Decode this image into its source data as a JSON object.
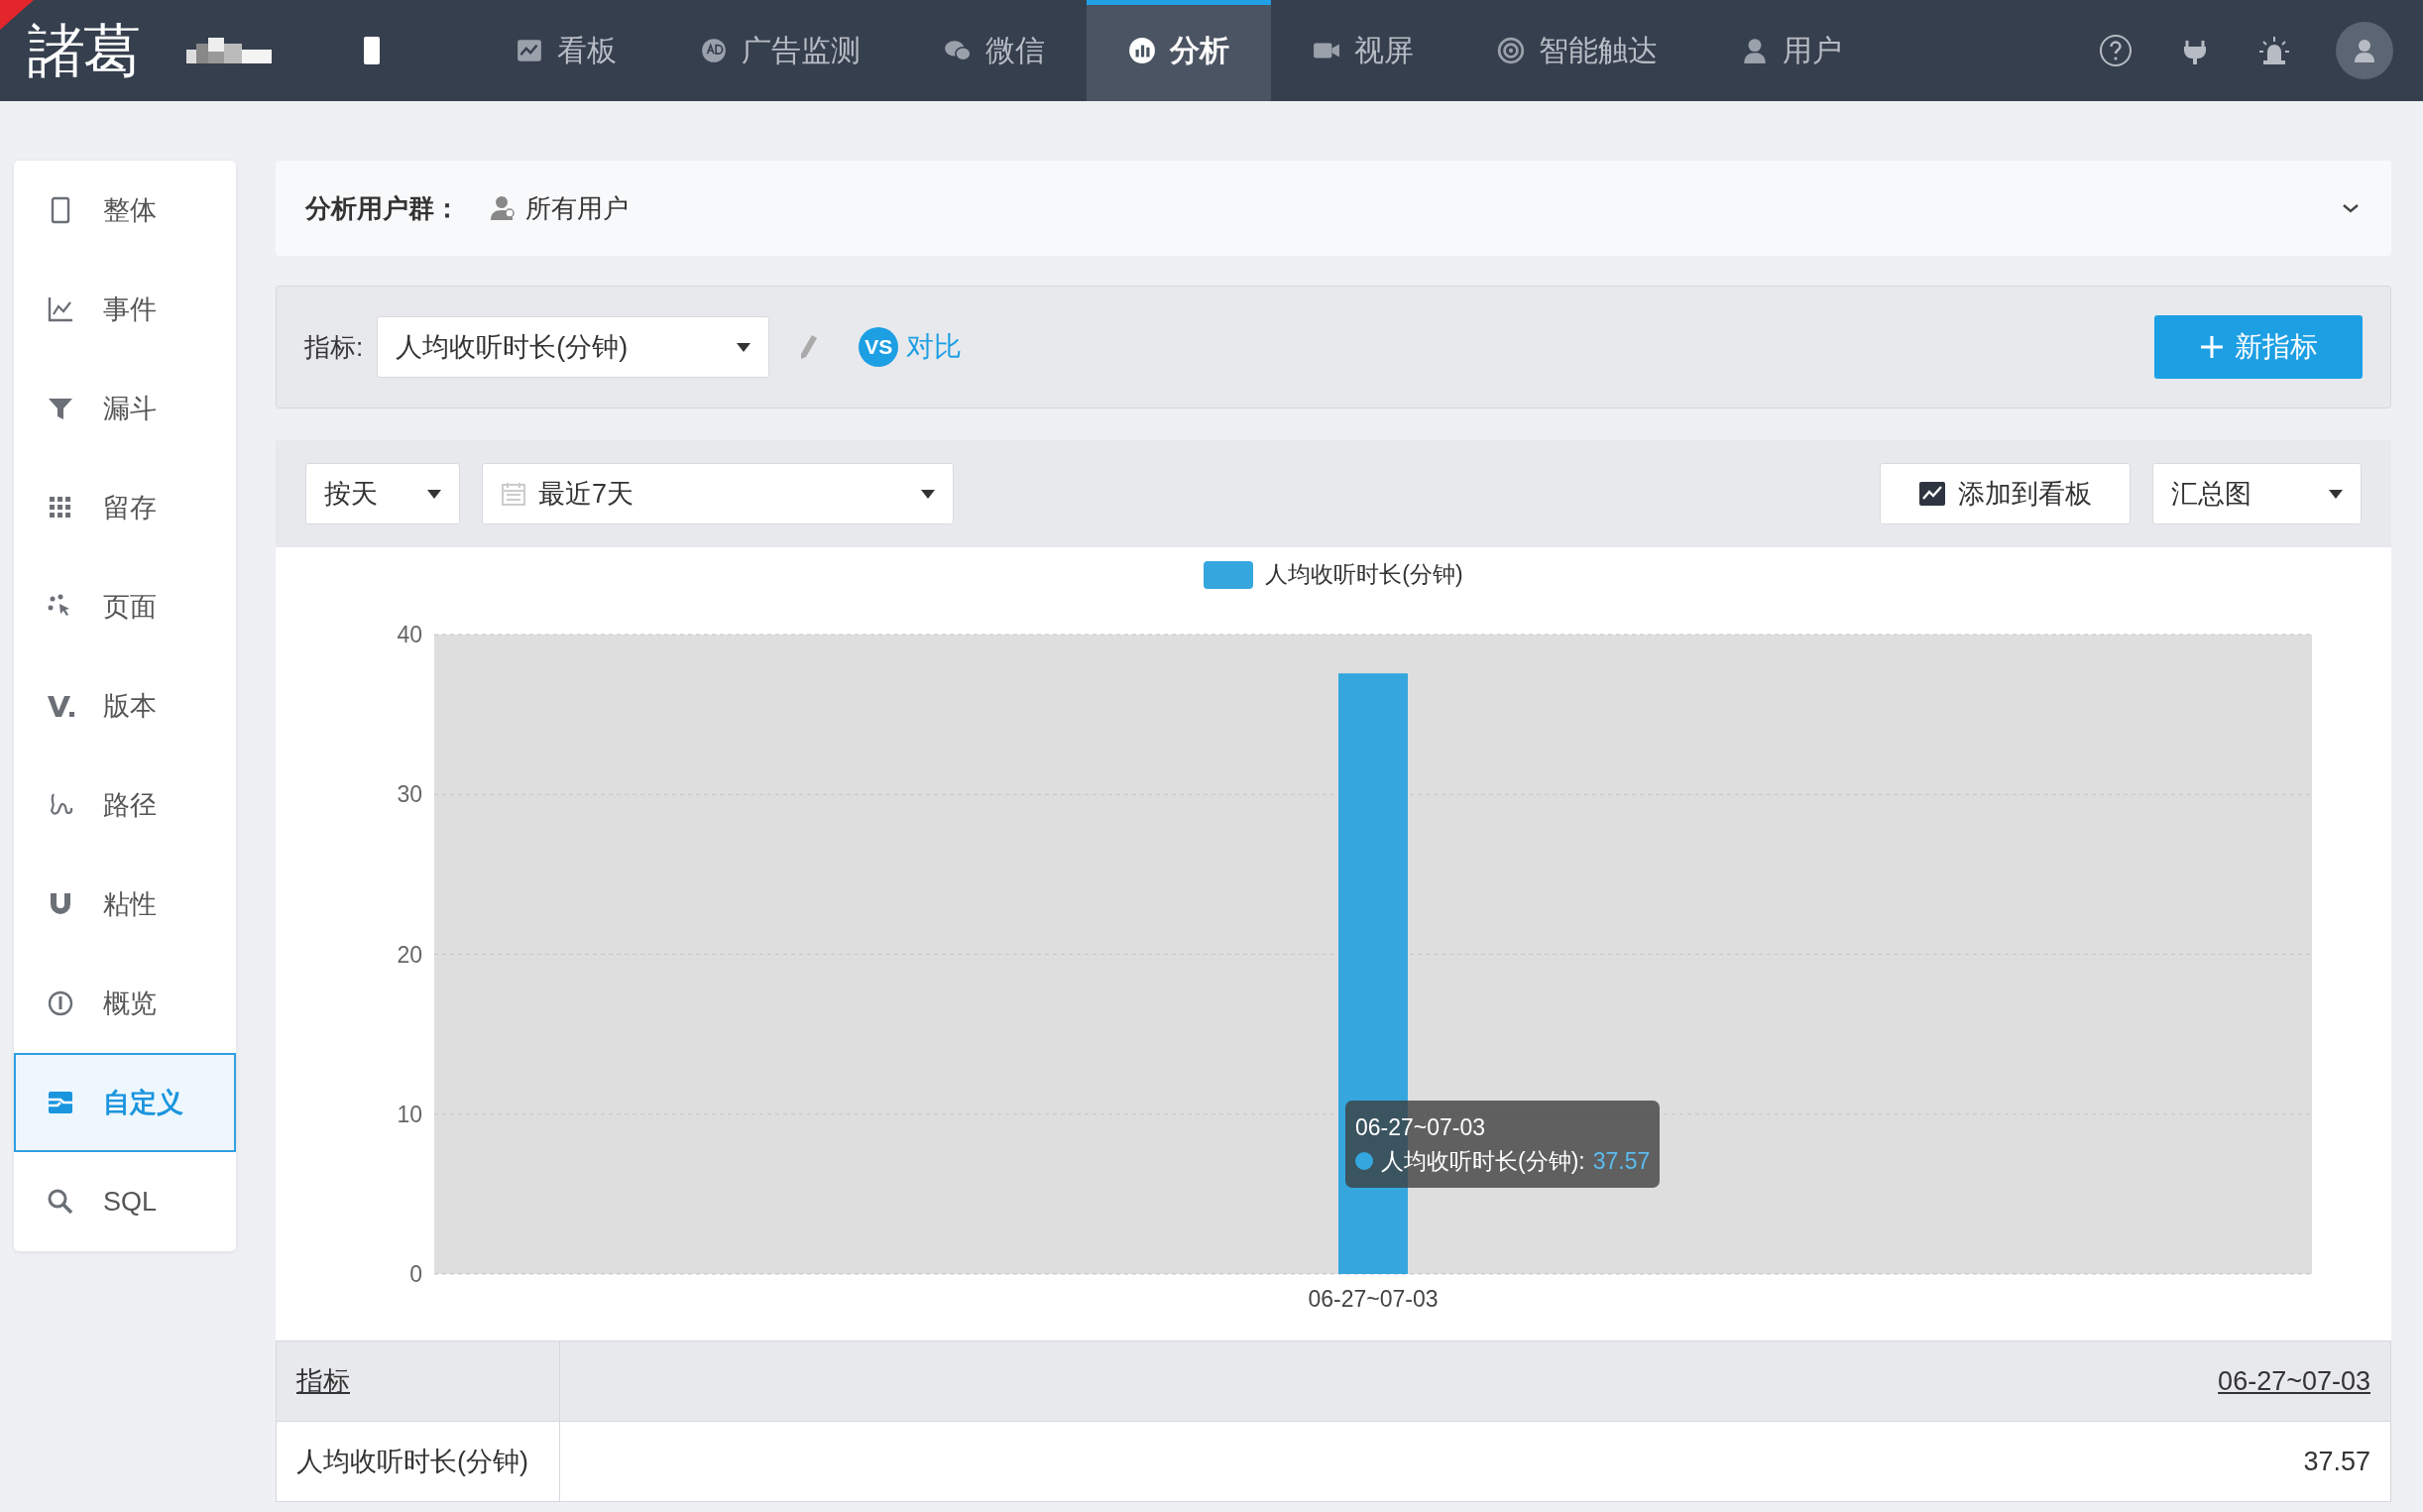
{
  "header": {
    "logo": "諸葛",
    "nav": [
      {
        "label": "看板",
        "selected": false
      },
      {
        "label": "广告监测",
        "selected": false
      },
      {
        "label": "微信",
        "selected": false
      },
      {
        "label": "分析",
        "selected": true
      },
      {
        "label": "视屏",
        "selected": false
      },
      {
        "label": "智能触达",
        "selected": false
      },
      {
        "label": "用户",
        "selected": false
      }
    ]
  },
  "sidebar": {
    "items": [
      {
        "label": "整体",
        "selected": false
      },
      {
        "label": "事件",
        "selected": false
      },
      {
        "label": "漏斗",
        "selected": false
      },
      {
        "label": "留存",
        "selected": false
      },
      {
        "label": "页面",
        "selected": false
      },
      {
        "label": "版本",
        "selected": false
      },
      {
        "label": "路径",
        "selected": false
      },
      {
        "label": "粘性",
        "selected": false
      },
      {
        "label": "概览",
        "selected": false
      },
      {
        "label": "自定义",
        "selected": true
      },
      {
        "label": "SQL",
        "selected": false
      }
    ]
  },
  "user_group": {
    "label": "分析用户群：",
    "value": "所有用户"
  },
  "metric_bar": {
    "label": "指标:",
    "metric": "人均收听时长(分钟)",
    "compare_badge": "VS",
    "compare": "对比",
    "add_button": "新指标"
  },
  "toolbar": {
    "granularity": "按天",
    "date_range": "最近7天",
    "add_to_board": "添加到看板",
    "chart_type": "汇总图"
  },
  "chart": {
    "chart_data": {
      "type": "bar",
      "categories": [
        "06-27~07-03"
      ],
      "series": [
        {
          "name": "人均收听时长(分钟)",
          "color": "#35a7de",
          "values": [
            37.57
          ]
        }
      ],
      "ylim": [
        0,
        40
      ],
      "yticks": [
        0,
        10,
        20,
        30,
        40
      ],
      "grid": true
    },
    "tooltip": {
      "title": "06-27~07-03",
      "label": "人均收听时长(分钟):",
      "value": "37.57"
    }
  },
  "table": {
    "columns": [
      "指标",
      "06-27~07-03"
    ],
    "rows": [
      [
        "人均收听时长(分钟)",
        "37.57"
      ]
    ]
  }
}
